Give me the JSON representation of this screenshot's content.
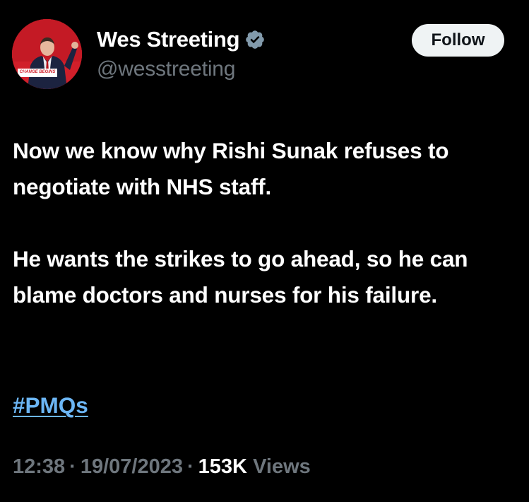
{
  "tweet": {
    "author": {
      "display_name": "Wes Streeting",
      "handle": "@wesstreeting",
      "verified": true,
      "avatar_banner_text": "CHANGE BEGINS"
    },
    "follow_label": "Follow",
    "paragraphs": [
      "Now we know why Rishi Sunak refuses to negotiate with NHS staff.",
      "He wants the strikes to go ahead, so he can blame doctors and nurses for his failure."
    ],
    "hashtag": "#PMQs",
    "meta": {
      "time": "12:38",
      "date": "19/07/2023",
      "separator": "·",
      "views_count": "153K",
      "views_label": "Views"
    }
  },
  "colors": {
    "background": "#000000",
    "text_primary": "#ffffff",
    "text_secondary": "#6e767d",
    "link": "#6cb6f5",
    "follow_button_bg": "#eff3f4",
    "verified_badge": "#829aab"
  }
}
